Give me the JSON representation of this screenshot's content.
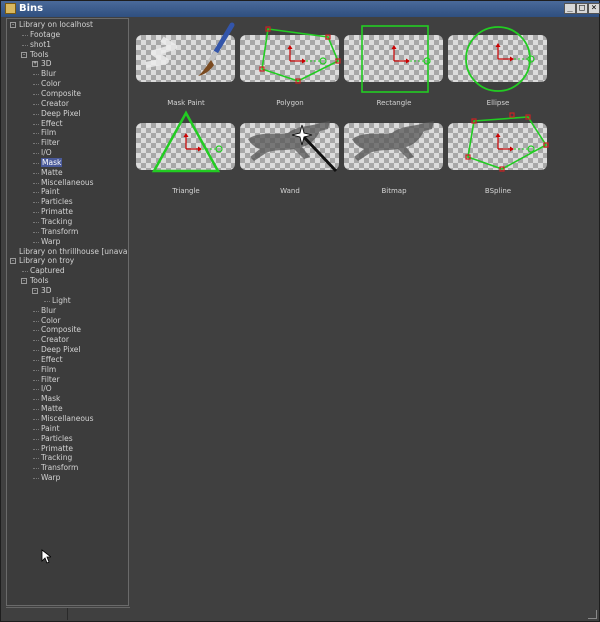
{
  "window": {
    "title": "Bins",
    "buttons": {
      "minimize": "_",
      "maximize": "□",
      "close": "×"
    }
  },
  "tree": [
    {
      "label": "Library on localhost",
      "depth": 0,
      "toggle": "-"
    },
    {
      "label": "Footage",
      "depth": 1
    },
    {
      "label": "shot1",
      "depth": 1
    },
    {
      "label": "Tools",
      "depth": 1,
      "toggle": "-"
    },
    {
      "label": "3D",
      "depth": 2,
      "toggle": "+"
    },
    {
      "label": "Blur",
      "depth": 2
    },
    {
      "label": "Color",
      "depth": 2
    },
    {
      "label": "Composite",
      "depth": 2
    },
    {
      "label": "Creator",
      "depth": 2
    },
    {
      "label": "Deep Pixel",
      "depth": 2
    },
    {
      "label": "Effect",
      "depth": 2
    },
    {
      "label": "Film",
      "depth": 2
    },
    {
      "label": "Filter",
      "depth": 2
    },
    {
      "label": "I/O",
      "depth": 2
    },
    {
      "label": "Mask",
      "depth": 2,
      "selected": true
    },
    {
      "label": "Matte",
      "depth": 2
    },
    {
      "label": "Miscellaneous",
      "depth": 2
    },
    {
      "label": "Paint",
      "depth": 2
    },
    {
      "label": "Particles",
      "depth": 2
    },
    {
      "label": "Primatte",
      "depth": 2
    },
    {
      "label": "Tracking",
      "depth": 2
    },
    {
      "label": "Transform",
      "depth": 2
    },
    {
      "label": "Warp",
      "depth": 2
    },
    {
      "label": "Library on thrillhouse [unavailable]",
      "depth": 0
    },
    {
      "label": "Library on troy",
      "depth": 0,
      "toggle": "-"
    },
    {
      "label": "Captured",
      "depth": 1
    },
    {
      "label": "Tools",
      "depth": 1,
      "toggle": "-"
    },
    {
      "label": "3D",
      "depth": 2,
      "toggle": "-"
    },
    {
      "label": "Light",
      "depth": 3
    },
    {
      "label": "Blur",
      "depth": 2
    },
    {
      "label": "Color",
      "depth": 2
    },
    {
      "label": "Composite",
      "depth": 2
    },
    {
      "label": "Creator",
      "depth": 2
    },
    {
      "label": "Deep Pixel",
      "depth": 2
    },
    {
      "label": "Effect",
      "depth": 2
    },
    {
      "label": "Film",
      "depth": 2
    },
    {
      "label": "Filter",
      "depth": 2
    },
    {
      "label": "I/O",
      "depth": 2
    },
    {
      "label": "Mask",
      "depth": 2
    },
    {
      "label": "Matte",
      "depth": 2
    },
    {
      "label": "Miscellaneous",
      "depth": 2
    },
    {
      "label": "Paint",
      "depth": 2
    },
    {
      "label": "Particles",
      "depth": 2
    },
    {
      "label": "Primatte",
      "depth": 2
    },
    {
      "label": "Tracking",
      "depth": 2
    },
    {
      "label": "Transform",
      "depth": 2
    },
    {
      "label": "Warp",
      "depth": 2
    }
  ],
  "tools": [
    {
      "label": "Mask Paint",
      "icon": "mask-paint-icon"
    },
    {
      "label": "Polygon",
      "icon": "polygon-icon"
    },
    {
      "label": "Rectangle",
      "icon": "rectangle-icon"
    },
    {
      "label": "Ellipse",
      "icon": "ellipse-icon"
    },
    {
      "label": "Triangle",
      "icon": "triangle-icon"
    },
    {
      "label": "Wand",
      "icon": "wand-icon"
    },
    {
      "label": "Bitmap",
      "icon": "bitmap-icon"
    },
    {
      "label": "BSpline",
      "icon": "bspline-icon"
    }
  ],
  "colors": {
    "shape_outline": "#22cc22",
    "control_point": "#cc2222",
    "axis": "#cc0000",
    "selection": "#4a5a9a",
    "panel": "#404040"
  }
}
